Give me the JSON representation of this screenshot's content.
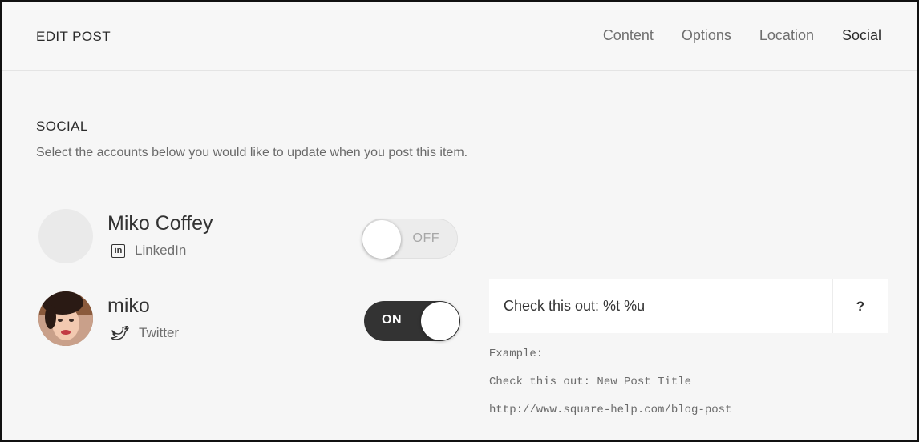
{
  "header": {
    "title": "EDIT POST",
    "tabs": [
      {
        "label": "Content",
        "active": false
      },
      {
        "label": "Options",
        "active": false
      },
      {
        "label": "Location",
        "active": false
      },
      {
        "label": "Social",
        "active": true
      }
    ]
  },
  "section": {
    "title": "SOCIAL",
    "description": "Select the accounts below you would like to update when you post this item."
  },
  "accounts": [
    {
      "name": "Miko Coffey",
      "service": "LinkedIn",
      "service_icon": "linkedin-icon",
      "toggle_label": "OFF",
      "enabled": false
    },
    {
      "name": "miko",
      "service": "Twitter",
      "service_icon": "twitter-bird-icon",
      "toggle_label": "ON",
      "enabled": true
    }
  ],
  "twitter_template": {
    "value": "Check this out: %t %u",
    "help_label": "?",
    "example_heading": "Example:",
    "example_text": "Check this out: New Post Title",
    "example_url": "http://www.square-help.com/blog-post"
  },
  "colors": {
    "toggle_on": "#333333",
    "toggle_off": "#ececec",
    "panel_background": "#f6f6f6"
  }
}
